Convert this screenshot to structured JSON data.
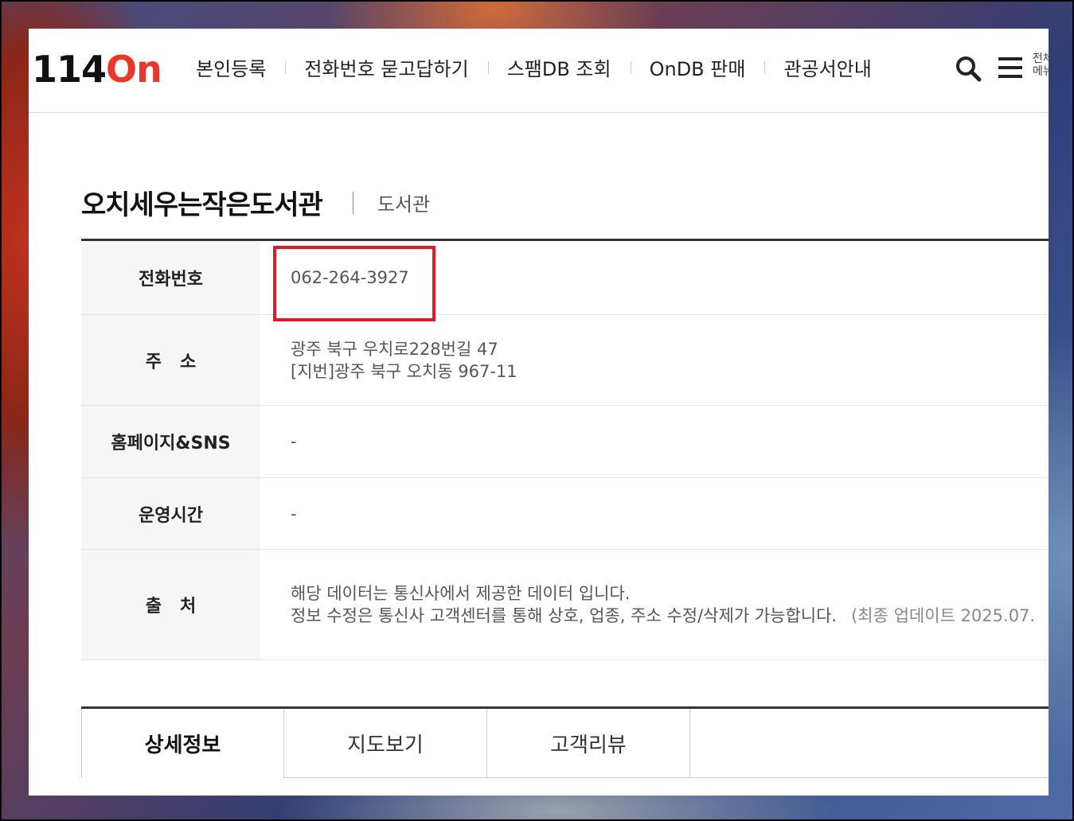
{
  "header": {
    "logo_num": "114",
    "logo_on": "On",
    "nav": [
      "본인등록",
      "전화번호 묻고답하기",
      "스팸DB 조회",
      "OnDB 판매",
      "관공서안내"
    ],
    "all_menu_label": "전체 메뉴",
    "icons": [
      "search-icon",
      "hamburger-menu-icon"
    ]
  },
  "place": {
    "name": "오치세우는작은도서관",
    "category": "도서관"
  },
  "info": {
    "phone_label": "전화번호",
    "phone": "062-264-3927",
    "address_label": "주   소",
    "address_road": "광주 북구 우치로228번길 47",
    "address_lot": "[지번]광주 북구 오치동 967-11",
    "web_label": "홈페이지&SNS",
    "web": "-",
    "hours_label": "운영시간",
    "hours": "-",
    "source_label": "출   처",
    "source_line1": "해당 데이터는 통신사에서 제공한 데이터 입니다.",
    "source_line2": "정보 수정은 통신사 고객센터를 통해 상호, 업종, 주소 수정/삭제가 가능합니다.",
    "update_note": "(최종 업데이트 2025.07."
  },
  "colors": {
    "brand_red": "#e8382b",
    "highlight": "#e01b24"
  },
  "tabs": [
    "상세정보",
    "지도보기",
    "고객리뷰"
  ]
}
